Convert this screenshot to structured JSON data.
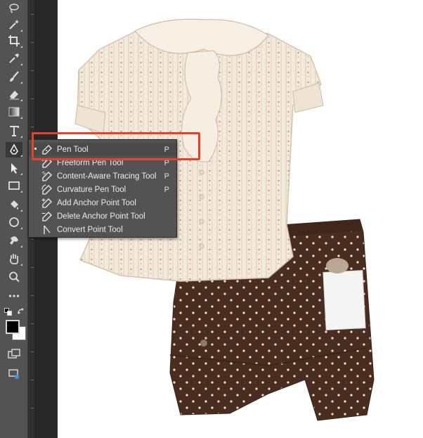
{
  "toolbar": {
    "tools": [
      {
        "name": "lasso-icon"
      },
      {
        "name": "magic-wand-icon"
      },
      {
        "name": "crop-icon"
      },
      {
        "name": "eyedropper-icon"
      },
      {
        "name": "brush-icon"
      },
      {
        "name": "eraser-icon"
      },
      {
        "name": "gradient-icon"
      },
      {
        "name": "type-icon"
      },
      {
        "name": "pen-icon"
      },
      {
        "name": "path-selection-icon"
      },
      {
        "name": "rectangle-icon"
      },
      {
        "name": "paint-bucket-icon"
      },
      {
        "name": "ellipse-icon"
      },
      {
        "name": "puppet-warp-icon"
      },
      {
        "name": "hand-icon"
      },
      {
        "name": "zoom-icon"
      },
      {
        "name": "more-tools-icon"
      }
    ],
    "foreground_color": "#000000",
    "background_color": "#ffffff"
  },
  "flyout": {
    "items": [
      {
        "label": "Pen Tool",
        "shortcut": "P",
        "icon": "pen-icon",
        "selected": true
      },
      {
        "label": "Freeform Pen Tool",
        "shortcut": "P",
        "icon": "freeform-pen-icon"
      },
      {
        "label": "Content-Aware Tracing Tool",
        "shortcut": "P",
        "icon": "content-aware-tracing-icon"
      },
      {
        "label": "Curvature Pen Tool",
        "shortcut": "P",
        "icon": "curvature-pen-icon"
      },
      {
        "label": "Add Anchor Point Tool",
        "shortcut": "",
        "icon": "add-anchor-point-icon"
      },
      {
        "label": "Delete Anchor Point Tool",
        "shortcut": "",
        "icon": "delete-anchor-point-icon"
      },
      {
        "label": "Convert Point Tool",
        "shortcut": "",
        "icon": "convert-point-icon"
      }
    ]
  },
  "colors": {
    "highlight": "#e0452b",
    "toolbar_bg": "#535353",
    "shirt": "#f3e8d8",
    "shorts": "#4a2e22"
  }
}
